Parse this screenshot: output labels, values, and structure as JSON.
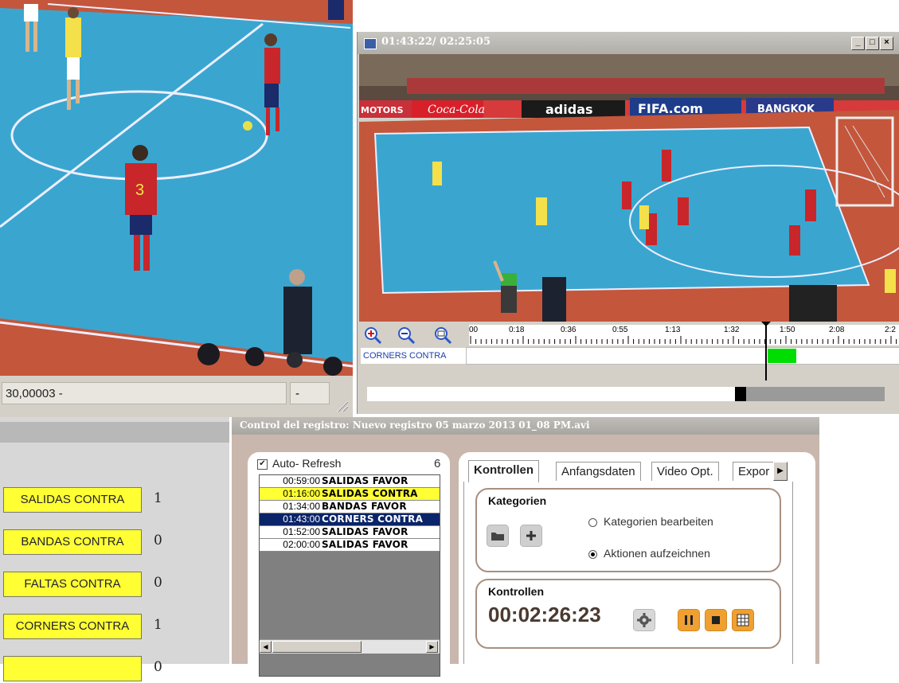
{
  "left_video": {
    "status_value": "30,00003",
    "status_sep": "-",
    "status_right": "-",
    "scoreboard_number": "3"
  },
  "video_window": {
    "title": "01:43:22/ 02:25:05",
    "minimize": "_",
    "maximize": "□",
    "close": "×",
    "ads": [
      "MOTORS",
      "Coca-Cola",
      "adidas",
      "FIFA.com",
      "BANGKOK"
    ],
    "zoom_buttons": [
      "zoom-in-icon",
      "zoom-out-icon",
      "zoom-reset-icon"
    ],
    "ruler_ticks": [
      "00",
      "0:18",
      "0:36",
      "0:55",
      "1:13",
      "1:32",
      "1:50",
      "2:08",
      "2:2"
    ],
    "track_label": "CORNERS CONTRA",
    "accent_green": "#00dd00"
  },
  "left_panel": {
    "categories": [
      {
        "label": "SALIDAS CONTRA",
        "count": "1"
      },
      {
        "label": "BANDAS CONTRA",
        "count": "0"
      },
      {
        "label": "FALTAS CONTRA",
        "count": "0"
      },
      {
        "label": "CORNERS CONTRA",
        "count": "1"
      },
      {
        "label": "",
        "count": "0"
      }
    ],
    "button_color": "#ffff33"
  },
  "control": {
    "title": "Control del registro: Nuevo registro 05 marzo 2013 01_08 PM.avi",
    "auto_refresh_label": "Auto- Refresh",
    "auto_refresh_checked": "✔",
    "event_count": "6",
    "events": [
      {
        "time": "00:59:00",
        "name": "SALIDAS FAVOR"
      },
      {
        "time": "01:16:00",
        "name": "SALIDAS CONTRA"
      },
      {
        "time": "01:34:00",
        "name": "BANDAS FAVOR"
      },
      {
        "time": "01:43:00",
        "name": "CORNERS CONTRA"
      },
      {
        "time": "01:52:00",
        "name": "SALIDAS FAVOR"
      },
      {
        "time": "02:00:00",
        "name": "SALIDAS FAVOR"
      }
    ],
    "tabs": [
      "Kontrollen",
      "Anfangsdaten",
      "Video Opt.",
      "Expor"
    ],
    "tab_more": "▶",
    "kategorien_title": "Kategorien",
    "radio_edit": "Kategorien bearbeiten",
    "radio_record": "Aktionen aufzeichnen",
    "kontrollen_title": "Kontrollen",
    "timer": "00:02:26:23",
    "scroll_left": "◀",
    "scroll_right": "▶"
  }
}
